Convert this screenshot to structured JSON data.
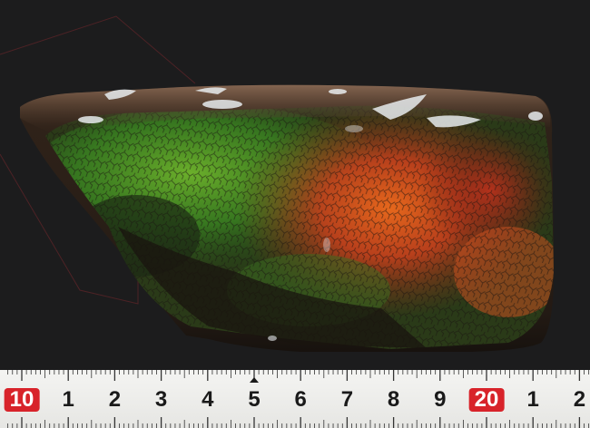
{
  "photo": {
    "subject": "ammolite-specimen",
    "colors": {
      "background": "#1c1c1d",
      "matrix": "#3a2a1c",
      "iridescent_green": "#3f9a2a",
      "iridescent_orange": "#e0551c",
      "iridescent_red": "#b8281c"
    }
  },
  "ruler": {
    "accent_color": "#d8232a",
    "labels": [
      {
        "text": "10",
        "highlight": true
      },
      {
        "text": "1",
        "highlight": false
      },
      {
        "text": "2",
        "highlight": false
      },
      {
        "text": "3",
        "highlight": false
      },
      {
        "text": "4",
        "highlight": false
      },
      {
        "text": "5",
        "highlight": false
      },
      {
        "text": "6",
        "highlight": false
      },
      {
        "text": "7",
        "highlight": false
      },
      {
        "text": "8",
        "highlight": false
      },
      {
        "text": "9",
        "highlight": false
      },
      {
        "text": "20",
        "highlight": true
      },
      {
        "text": "1",
        "highlight": false
      },
      {
        "text": "2",
        "highlight": false
      }
    ]
  }
}
